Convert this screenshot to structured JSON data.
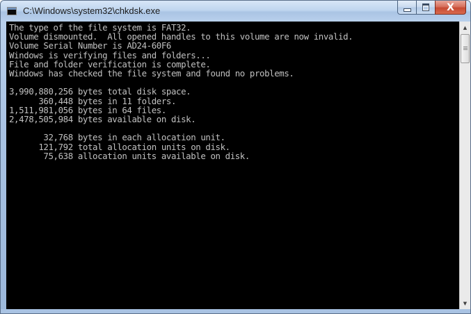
{
  "window": {
    "title": "C:\\Windows\\system32\\chkdsk.exe"
  },
  "caption_buttons": {
    "minimize_icon": "minimize-icon",
    "maximize_icon": "maximize-icon",
    "close_icon": "close-icon",
    "close_glyph": "X"
  },
  "console": {
    "lines": [
      "The type of the file system is FAT32.",
      "Volume dismounted.  All opened handles to this volume are now invalid.",
      "Volume Serial Number is AD24-60F6",
      "Windows is verifying files and folders...",
      "File and folder verification is complete.",
      "Windows has checked the file system and found no problems.",
      "",
      "3,990,880,256 bytes total disk space.",
      "      360,448 bytes in 11 folders.",
      "1,511,981,056 bytes in 64 files.",
      "2,478,505,984 bytes available on disk.",
      "",
      "       32,768 bytes in each allocation unit.",
      "      121,792 total allocation units on disk.",
      "       75,638 allocation units available on disk."
    ],
    "text_color": "#c0c0c0",
    "background_color": "#000000"
  },
  "scrollbar": {
    "up_glyph": "▲",
    "down_glyph": "▼"
  }
}
